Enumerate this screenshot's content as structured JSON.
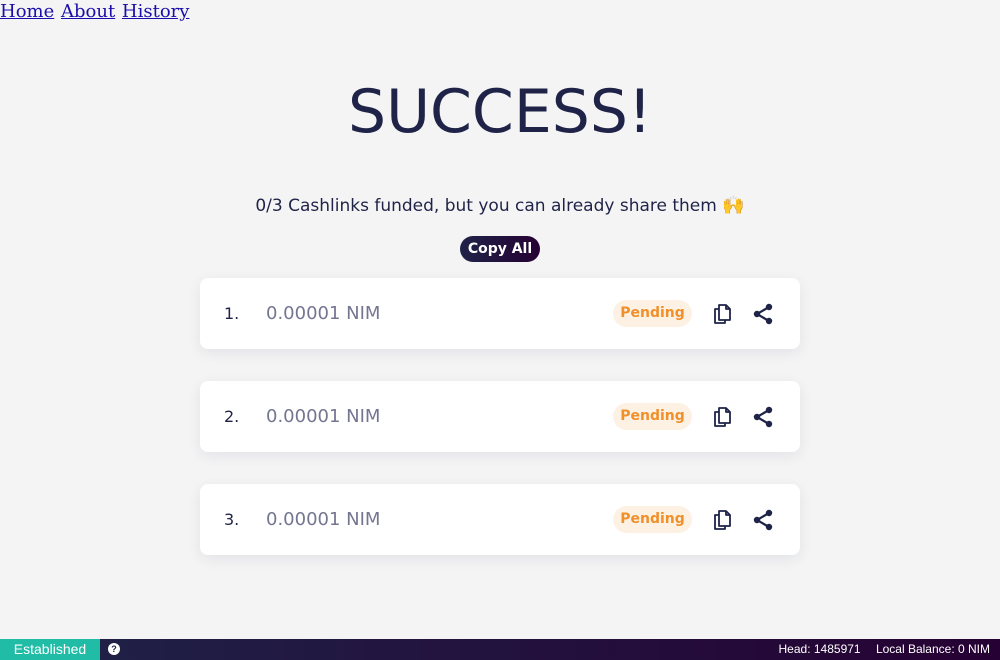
{
  "nav": {
    "links": [
      "Home",
      "About",
      "History"
    ]
  },
  "main": {
    "title": "SUCCESS!",
    "subtitle": "0/3 Cashlinks funded, but you can already share them",
    "subtitle_emoji": "🙌",
    "copy_all_label": "Copy All"
  },
  "cashlinks": [
    {
      "index": "1.",
      "amount": "0.00001 NIM",
      "status": "Pending"
    },
    {
      "index": "2.",
      "amount": "0.00001 NIM",
      "status": "Pending"
    },
    {
      "index": "3.",
      "amount": "0.00001 NIM",
      "status": "Pending"
    }
  ],
  "icons": {
    "copy": "copy-icon",
    "share": "share-icon",
    "help": "help-icon"
  },
  "statusbar": {
    "connection": "Established",
    "help_glyph": "?",
    "head": "Head: 1485971",
    "balance": "Local Balance: 0 NIM"
  },
  "colors": {
    "navy": "#1f2348",
    "pending_text": "#f0902a",
    "pending_bg": "#fdf1e4",
    "established": "#21bca5"
  }
}
